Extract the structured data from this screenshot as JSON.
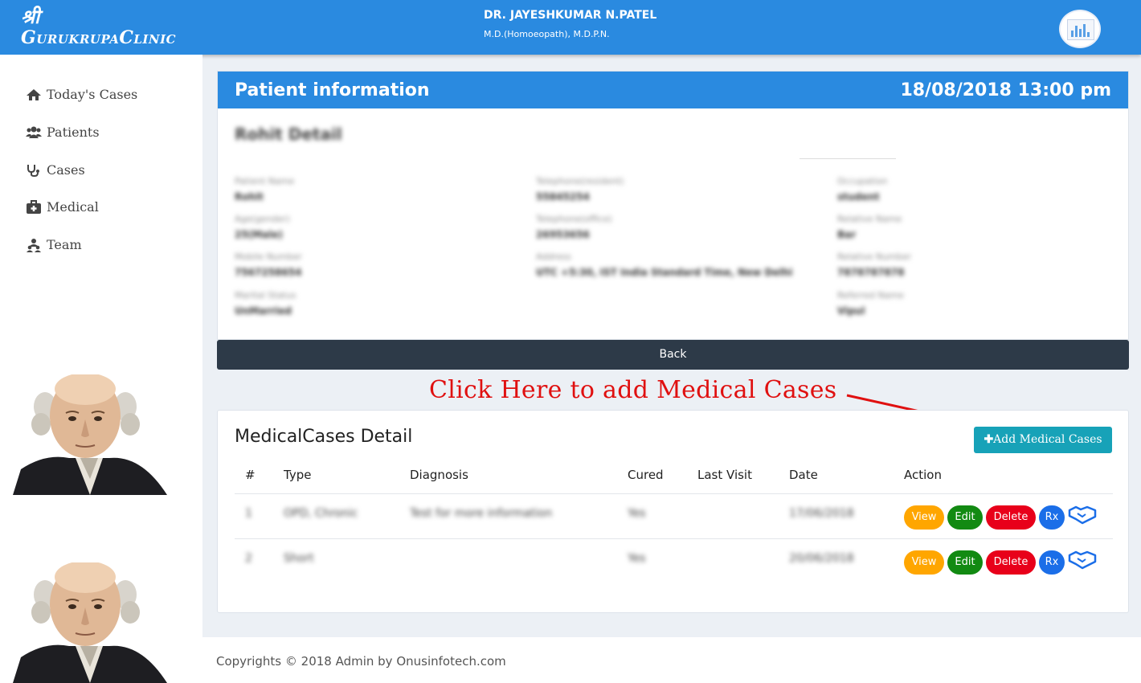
{
  "app": {
    "logo_top": "श्री",
    "logo_name": "GurukrupaClinic"
  },
  "doctor": {
    "name": "DR. JAYESHKUMAR N.PATEL",
    "degree": "M.D.(Homoeopath), M.D.P.N."
  },
  "sidebar": {
    "items": [
      {
        "label": "Today's Cases",
        "icon": "home-icon"
      },
      {
        "label": "Patients",
        "icon": "users-icon"
      },
      {
        "label": "Cases",
        "icon": "stethoscope-icon"
      },
      {
        "label": "Medical",
        "icon": "medkit-icon"
      },
      {
        "label": "Team",
        "icon": "team-icon"
      }
    ]
  },
  "patient": {
    "header_title": "Patient information",
    "datetime": "18/08/2018 13:00 pm",
    "detail_title": "Rohit Detail",
    "fields": [
      {
        "label": "Patient Name",
        "value": "Rohit"
      },
      {
        "label": "Telephone(resident)",
        "value": "55845254"
      },
      {
        "label": "Occupation",
        "value": "student"
      },
      {
        "label": "Age(gender)",
        "value": "25(Male)"
      },
      {
        "label": "Telephone(office)",
        "value": "26953656"
      },
      {
        "label": "Relative Name",
        "value": "Bar"
      },
      {
        "label": "Mobile Number",
        "value": "7567258654"
      },
      {
        "label": "Address",
        "value": "UTC +5:30, IST India Standard Time, New Delhi"
      },
      {
        "label": "Relative Number",
        "value": "7878787878"
      },
      {
        "label": "Marital Status",
        "value": "UnMarried"
      },
      {
        "label": "Referred Name",
        "value": "Vipul"
      }
    ],
    "back_label": "Back"
  },
  "annotation": "Click Here to add Medical Cases",
  "cases": {
    "title": "MedicalCases Detail",
    "add_label": "Add Medical Cases",
    "columns": [
      "#",
      "Type",
      "Diagnosis",
      "Cured",
      "Last Visit",
      "Date",
      "Action"
    ],
    "rows": [
      {
        "num": "1",
        "type": "OPD, Chronic",
        "diagnosis": "Test for more information",
        "cured": "Yes",
        "last_visit": "",
        "date": "17/06/2018"
      },
      {
        "num": "2",
        "type": "Short",
        "diagnosis": "",
        "cured": "Yes",
        "last_visit": "",
        "date": "20/06/2018"
      }
    ],
    "actions": {
      "view": "View",
      "edit": "Edit",
      "delete": "Delete",
      "rx": "Rx"
    }
  },
  "footer": "Copyrights © 2018 Admin by Onusinfotech.com",
  "colors": {
    "primary": "#2a8ae0",
    "dark": "#2d3a48",
    "annotation": "#e01010",
    "add_button": "#17a2b8"
  }
}
